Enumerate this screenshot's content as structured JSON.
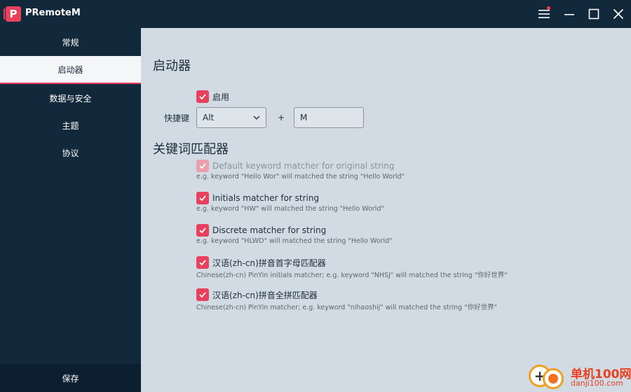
{
  "titlebar": {
    "app_logo_letter": "P",
    "app_title": "PRemoteM"
  },
  "sidebar": {
    "items": [
      {
        "label": "常规",
        "active": false
      },
      {
        "label": "启动器",
        "active": true
      },
      {
        "label": "数据与安全",
        "active": false
      },
      {
        "label": "主题",
        "active": false
      },
      {
        "label": "协议",
        "active": false
      }
    ],
    "save_label": "保存"
  },
  "launcher": {
    "title": "启动器",
    "enable_label": "启用",
    "enabled": true,
    "hotkey_label": "快捷键",
    "modifier_value": "Alt",
    "plus_label": "+",
    "key_value": "M"
  },
  "keyword_matcher": {
    "title": "关键词匹配器",
    "matchers": [
      {
        "label": "Default keyword matcher for original string",
        "description": "e.g. keyword \"Hello Wor\" will matched the string \"Hello World\"",
        "checked": true,
        "disabled": true
      },
      {
        "label": "Initials matcher for string",
        "description": "e.g. keyword \"HW\" will matched the string \"Hello World\"",
        "checked": true,
        "disabled": false
      },
      {
        "label": "Discrete matcher for string",
        "description": "e.g. keyword \"HLWD\" will matched the string \"Hello World\"",
        "checked": true,
        "disabled": false
      },
      {
        "label": "汉语(zh-cn)拼音首字母匹配器",
        "description": "Chinese(zh-cn) PinYin initials matcher; e.g. keyword \"NHSJ\" will matched the string \"你好世界\"",
        "checked": true,
        "disabled": false
      },
      {
        "label": "汉语(zh-cn)拼音全拼匹配器",
        "description": "Chinese(zh-cn) PinYin matcher; e.g. keyword \"nihaoshij\" will matched the string \"你好世界\"",
        "checked": true,
        "disabled": false
      }
    ]
  },
  "colors": {
    "accent": "#e8415d",
    "sidebar_bg": "#12283b",
    "content_bg": "#d2dbe3"
  },
  "watermark": {
    "text": "单机100网",
    "url": "danji100.com"
  }
}
